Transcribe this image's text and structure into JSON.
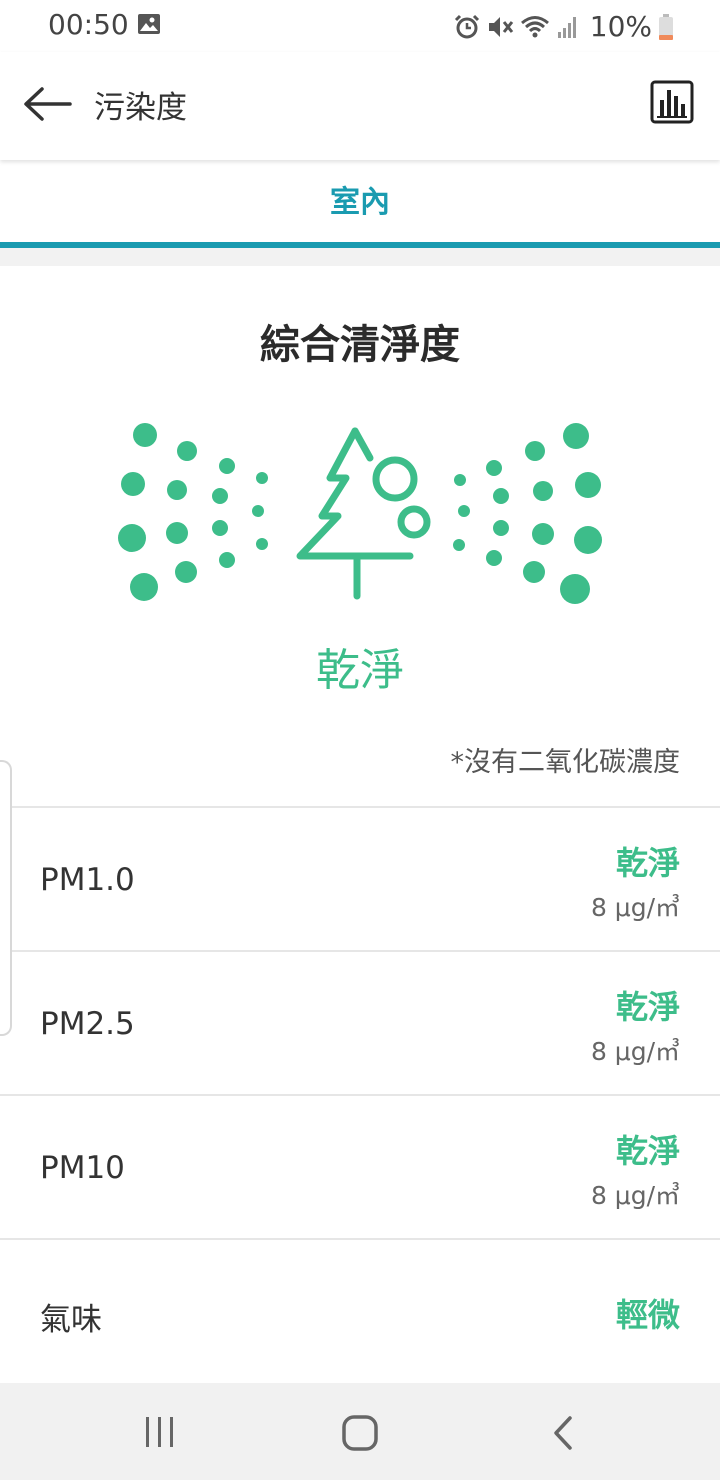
{
  "status_bar": {
    "time": "00:50",
    "battery": "10%",
    "icons": [
      "gallery-icon",
      "alarm-icon",
      "mute-icon",
      "wifi-icon",
      "signal-icon",
      "battery-icon"
    ]
  },
  "app_bar": {
    "title": "污染度",
    "back_icon": "arrow-left-icon",
    "chart_icon": "bar-chart-icon"
  },
  "tabs": [
    {
      "label": "室內",
      "selected": true
    }
  ],
  "colors": {
    "accent": "#1a9bb0",
    "clean_green": "#3dbd8a"
  },
  "overall": {
    "title": "綜合清淨度",
    "status": "乾淨",
    "illustration_icon": "tree-with-particles-icon",
    "note": "*沒有二氧化碳濃度"
  },
  "metrics": [
    {
      "name": "PM1.0",
      "level": "乾淨",
      "value": "8 μg/㎥"
    },
    {
      "name": "PM2.5",
      "level": "乾淨",
      "value": "8 μg/㎥"
    },
    {
      "name": "PM10",
      "level": "乾淨",
      "value": "8 μg/㎥"
    },
    {
      "name": "氣味",
      "level": "輕微",
      "value": ""
    }
  ],
  "nav_bar": {
    "icons": [
      "recent-apps-icon",
      "home-icon",
      "back-icon"
    ]
  }
}
